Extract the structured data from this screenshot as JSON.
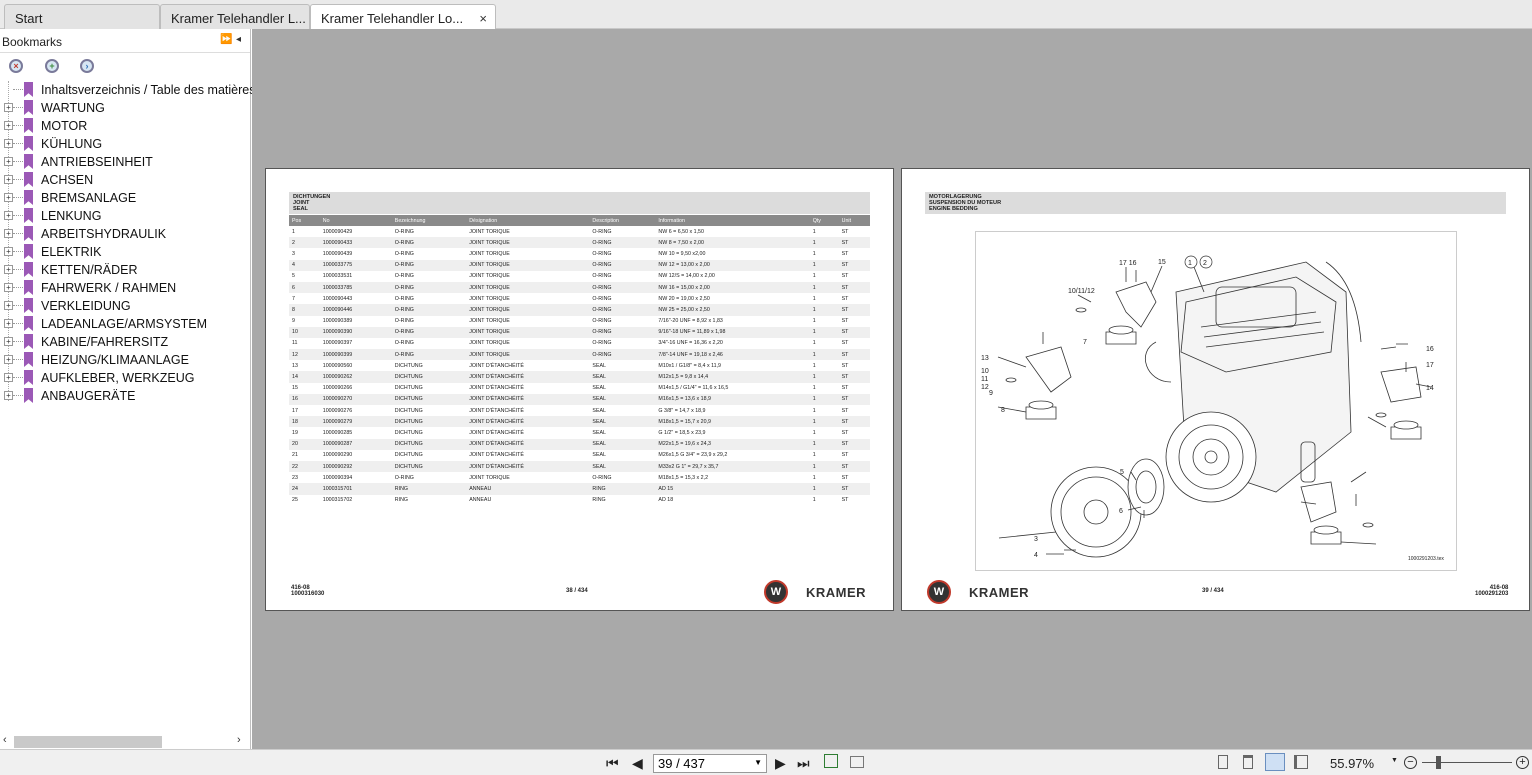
{
  "tabs": [
    {
      "label": "Start"
    },
    {
      "label": "Kramer Telehandler L..."
    },
    {
      "label": "Kramer Telehandler Lo...",
      "close": "×"
    }
  ],
  "sidebar": {
    "title": "Bookmarks",
    "expand_glyph": "⏩",
    "collapse_glyph": "◂",
    "items": [
      {
        "label": "Inhaltsverzeichnis / Table des matières",
        "expandable": false
      },
      {
        "label": "WARTUNG",
        "expandable": true
      },
      {
        "label": "MOTOR",
        "expandable": true
      },
      {
        "label": "KÜHLUNG",
        "expandable": true
      },
      {
        "label": "ANTRIEBSEINHEIT",
        "expandable": true
      },
      {
        "label": "ACHSEN",
        "expandable": true
      },
      {
        "label": "BREMSANLAGE",
        "expandable": true
      },
      {
        "label": "LENKUNG",
        "expandable": true
      },
      {
        "label": "ARBEITSHYDRAULIK",
        "expandable": true
      },
      {
        "label": "ELEKTRIK",
        "expandable": true
      },
      {
        "label": "KETTEN/RÄDER",
        "expandable": true
      },
      {
        "label": "FAHRWERK / RAHMEN",
        "expandable": true
      },
      {
        "label": "VERKLEIDUNG",
        "expandable": true
      },
      {
        "label": "LADEANLAGE/ARMSYSTEM",
        "expandable": true
      },
      {
        "label": "KABINE/FAHRERSITZ",
        "expandable": true
      },
      {
        "label": "HEIZUNG/KLIMAANLAGE",
        "expandable": true
      },
      {
        "label": "AUFKLEBER, WERKZEUG",
        "expandable": true
      },
      {
        "label": "ANBAUGERÄTE",
        "expandable": true
      }
    ]
  },
  "left_page": {
    "title_lines": [
      "DICHTUNGEN",
      "JOINT",
      "SEAL"
    ],
    "columns": [
      "Pos",
      "No",
      "Bezeichnung",
      "Désignation",
      "Description",
      "Information",
      "Qty",
      "Unit"
    ],
    "rows": [
      [
        "1",
        "1000090429",
        "O-RING",
        "JOINT TORIQUE",
        "O-RING",
        "NW 6 = 6,50 x 1,50",
        "1",
        "ST"
      ],
      [
        "2",
        "1000090433",
        "O-RING",
        "JOINT TORIQUE",
        "O-RING",
        "NW 8 = 7,50 x 2,00",
        "1",
        "ST"
      ],
      [
        "3",
        "1000090439",
        "O-RING",
        "JOINT TORIQUE",
        "O-RING",
        "NW 10 = 9,50 x2,00",
        "1",
        "ST"
      ],
      [
        "4",
        "1000033775",
        "O-RING",
        "JOINT TORIQUE",
        "O-RING",
        "NW 12 = 13,00 x 2,00",
        "1",
        "ST"
      ],
      [
        "5",
        "1000033531",
        "O-RING",
        "JOINT TORIQUE",
        "O-RING",
        "NW 12/S = 14,00 x 2,00",
        "1",
        "ST"
      ],
      [
        "6",
        "1000033785",
        "O-RING",
        "JOINT TORIQUE",
        "O-RING",
        "NW 16 = 15,00 x 2,00",
        "1",
        "ST"
      ],
      [
        "7",
        "1000090443",
        "O-RING",
        "JOINT TORIQUE",
        "O-RING",
        "NW 20 = 19,00 x 2,50",
        "1",
        "ST"
      ],
      [
        "8",
        "1000090446",
        "O-RING",
        "JOINT TORIQUE",
        "O-RING",
        "NW 25 = 25,00 x 2,50",
        "1",
        "ST"
      ],
      [
        "9",
        "1000090389",
        "O-RING",
        "JOINT TORIQUE",
        "O-RING",
        "7/16\"-20 UNF = 8,92 x 1,83",
        "1",
        "ST"
      ],
      [
        "10",
        "1000090390",
        "O-RING",
        "JOINT TORIQUE",
        "O-RING",
        "9/16\"-18 UNF = 11,89 x 1,98",
        "1",
        "ST"
      ],
      [
        "11",
        "1000090397",
        "O-RING",
        "JOINT TORIQUE",
        "O-RING",
        "3/4\"-16 UNF = 16,36 x 2,20",
        "1",
        "ST"
      ],
      [
        "12",
        "1000090399",
        "O-RING",
        "JOINT TORIQUE",
        "O-RING",
        "7/8\"-14 UNF = 19,18 x 2,46",
        "1",
        "ST"
      ],
      [
        "13",
        "1000090560",
        "DICHTUNG",
        "JOINT D'ÉTANCHÉITÉ",
        "SEAL",
        "M10x1 / G1/8\" = 8,4 x 11,9",
        "1",
        "ST"
      ],
      [
        "14",
        "1000090262",
        "DICHTUNG",
        "JOINT D'ÉTANCHÉITÉ",
        "SEAL",
        "M12x1,5 = 9,8 x 14,4",
        "1",
        "ST"
      ],
      [
        "15",
        "1000090266",
        "DICHTUNG",
        "JOINT D'ÉTANCHÉITÉ",
        "SEAL",
        "M14x1,5 / G1/4\" = 11,6 x 16,5",
        "1",
        "ST"
      ],
      [
        "16",
        "1000090270",
        "DICHTUNG",
        "JOINT D'ÉTANCHÉITÉ",
        "SEAL",
        "M16x1,5 = 13,6 x 18,9",
        "1",
        "ST"
      ],
      [
        "17",
        "1000090276",
        "DICHTUNG",
        "JOINT D'ÉTANCHÉITÉ",
        "SEAL",
        "G 3/8\" = 14,7 x 18,9",
        "1",
        "ST"
      ],
      [
        "18",
        "1000090279",
        "DICHTUNG",
        "JOINT D'ÉTANCHÉITÉ",
        "SEAL",
        "M18x1,5 = 15,7 x 20,9",
        "1",
        "ST"
      ],
      [
        "19",
        "1000090285",
        "DICHTUNG",
        "JOINT D'ÉTANCHÉITÉ",
        "SEAL",
        "G 1/2\" = 18,5 x 23,9",
        "1",
        "ST"
      ],
      [
        "20",
        "1000090287",
        "DICHTUNG",
        "JOINT D'ÉTANCHÉITÉ",
        "SEAL",
        "M22x1,5 = 19,6 x 24,3",
        "1",
        "ST"
      ],
      [
        "21",
        "1000090290",
        "DICHTUNG",
        "JOINT D'ÉTANCHÉITÉ",
        "SEAL",
        "M26x1,5 G 3/4\" = 23,9 x 29,2",
        "1",
        "ST"
      ],
      [
        "22",
        "1000090292",
        "DICHTUNG",
        "JOINT D'ÉTANCHÉITÉ",
        "SEAL",
        "M33x2 G 1\" = 29,7 x 35,7",
        "1",
        "ST"
      ],
      [
        "23",
        "1000090394",
        "O-RING",
        "JOINT TORIQUE",
        "O-RING",
        "M18x1,5 = 15,3 x 2,2",
        "1",
        "ST"
      ],
      [
        "24",
        "1000315701",
        "RING",
        "ANNEAU",
        "RING",
        "AD 15",
        "1",
        "ST"
      ],
      [
        "25",
        "1000315702",
        "RING",
        "ANNEAU",
        "RING",
        "AD 18",
        "1",
        "ST"
      ]
    ],
    "footer_code": "416-08",
    "footer_doc": "1000316030",
    "page_label": "38 / 434",
    "brand": "KRAMER"
  },
  "right_page": {
    "title_lines": [
      "MOTORLAGERUNG",
      "SUSPENSION DU MOTEUR",
      "ENGINE BEDDING"
    ],
    "callouts": [
      "1",
      "2",
      "3",
      "4",
      "5",
      "6",
      "7",
      "8",
      "9",
      "10",
      "11",
      "12",
      "13",
      "14",
      "15",
      "16",
      "17",
      "10/11/12",
      "17 16"
    ],
    "drawing_id": "1000291203.tex",
    "footer_code": "416-08",
    "footer_doc": "1000291203",
    "page_label": "39 / 434",
    "brand": "KRAMER"
  },
  "statusbar": {
    "first": "⏮",
    "prev": "◀",
    "page_value": "39 / 437",
    "next": "▶",
    "last": "⏭",
    "zoom": "55.97%"
  },
  "colors": {
    "viewer_bg": "#a9a9a9",
    "bookmark": "#9b59b6",
    "logo_ring": "#c0392b"
  }
}
